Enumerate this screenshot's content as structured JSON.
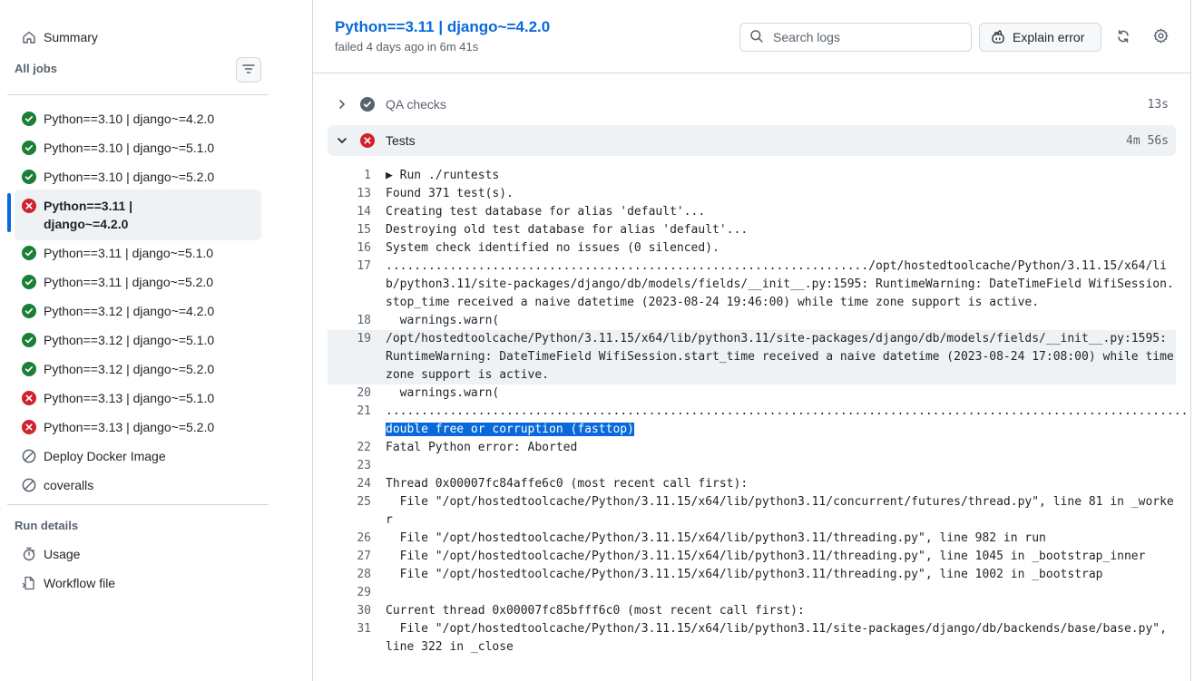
{
  "sidebar": {
    "summary_label": "Summary",
    "all_jobs_label": "All jobs",
    "run_details_label": "Run details",
    "usage_label": "Usage",
    "workflow_file_label": "Workflow file",
    "jobs": [
      {
        "label": "Python==3.10 | django~=4.2.0",
        "status": "success"
      },
      {
        "label": "Python==3.10 | django~=5.1.0",
        "status": "success"
      },
      {
        "label": "Python==3.10 | django~=5.2.0",
        "status": "success"
      },
      {
        "label": "Python==3.11 | django~=4.2.0",
        "status": "failure",
        "active": true
      },
      {
        "label": "Python==3.11 | django~=5.1.0",
        "status": "success"
      },
      {
        "label": "Python==3.11 | django~=5.2.0",
        "status": "success"
      },
      {
        "label": "Python==3.12 | django~=4.2.0",
        "status": "success"
      },
      {
        "label": "Python==3.12 | django~=5.1.0",
        "status": "success"
      },
      {
        "label": "Python==3.12 | django~=5.2.0",
        "status": "success"
      },
      {
        "label": "Python==3.13 | django~=5.1.0",
        "status": "failure"
      },
      {
        "label": "Python==3.13 | django~=5.2.0",
        "status": "failure"
      },
      {
        "label": "Deploy Docker Image",
        "status": "skipped"
      },
      {
        "label": "coveralls",
        "status": "skipped"
      }
    ]
  },
  "header": {
    "title": "Python==3.11 | django~=4.2.0",
    "subtitle": "failed 4 days ago in 6m 41s",
    "search_placeholder": "Search logs",
    "explain_label": "Explain error"
  },
  "steps": [
    {
      "label": "QA checks",
      "duration": "13s",
      "status": "neutral"
    },
    {
      "label": "Tests",
      "duration": "4m 56s",
      "status": "failure"
    }
  ],
  "log": [
    {
      "n": "1",
      "text": "▶ Run ./runtests"
    },
    {
      "n": "13",
      "text": "Found 371 test(s)."
    },
    {
      "n": "14",
      "text": "Creating test database for alias 'default'..."
    },
    {
      "n": "15",
      "text": "Destroying old test database for alias 'default'..."
    },
    {
      "n": "16",
      "text": "System check identified no issues (0 silenced)."
    },
    {
      "n": "17",
      "text": "..................................................................../opt/hostedtoolcache/Python/3.11.15/x64/lib/python3.11/site-packages/django/db/models/fields/__init__.py:1595: RuntimeWarning: DateTimeField WifiSession.stop_time received a naive datetime (2023-08-24 19:46:00) while time zone support is active."
    },
    {
      "n": "18",
      "text": "  warnings.warn("
    },
    {
      "n": "19",
      "text": "/opt/hostedtoolcache/Python/3.11.15/x64/lib/python3.11/site-packages/django/db/models/fields/__init__.py:1595: RuntimeWarning: DateTimeField WifiSession.start_time received a naive datetime (2023-08-24 17:08:00) while time zone support is active.",
      "highlight": true
    },
    {
      "n": "20",
      "text": "  warnings.warn("
    },
    {
      "n": "21",
      "text": ".................................................................................................................................................................................................................................................................",
      "selected": "double free or corruption (fasttop)"
    },
    {
      "n": "22",
      "text": "Fatal Python error: Aborted"
    },
    {
      "n": "23",
      "text": ""
    },
    {
      "n": "24",
      "text": "Thread 0x00007fc84affe6c0 (most recent call first):"
    },
    {
      "n": "25",
      "text": "  File \"/opt/hostedtoolcache/Python/3.11.15/x64/lib/python3.11/concurrent/futures/thread.py\", line 81 in _worker"
    },
    {
      "n": "26",
      "text": "  File \"/opt/hostedtoolcache/Python/3.11.15/x64/lib/python3.11/threading.py\", line 982 in run"
    },
    {
      "n": "27",
      "text": "  File \"/opt/hostedtoolcache/Python/3.11.15/x64/lib/python3.11/threading.py\", line 1045 in _bootstrap_inner"
    },
    {
      "n": "28",
      "text": "  File \"/opt/hostedtoolcache/Python/3.11.15/x64/lib/python3.11/threading.py\", line 1002 in _bootstrap"
    },
    {
      "n": "29",
      "text": ""
    },
    {
      "n": "30",
      "text": "Current thread 0x00007fc85bfff6c0 (most recent call first):"
    },
    {
      "n": "31",
      "text": "  File \"/opt/hostedtoolcache/Python/3.11.15/x64/lib/python3.11/site-packages/django/db/backends/base/base.py\", line 322 in _close"
    }
  ],
  "colors": {
    "success": "#1a7f37",
    "failure": "#cf222e",
    "neutral": "#59636e",
    "accent": "#0969da"
  }
}
